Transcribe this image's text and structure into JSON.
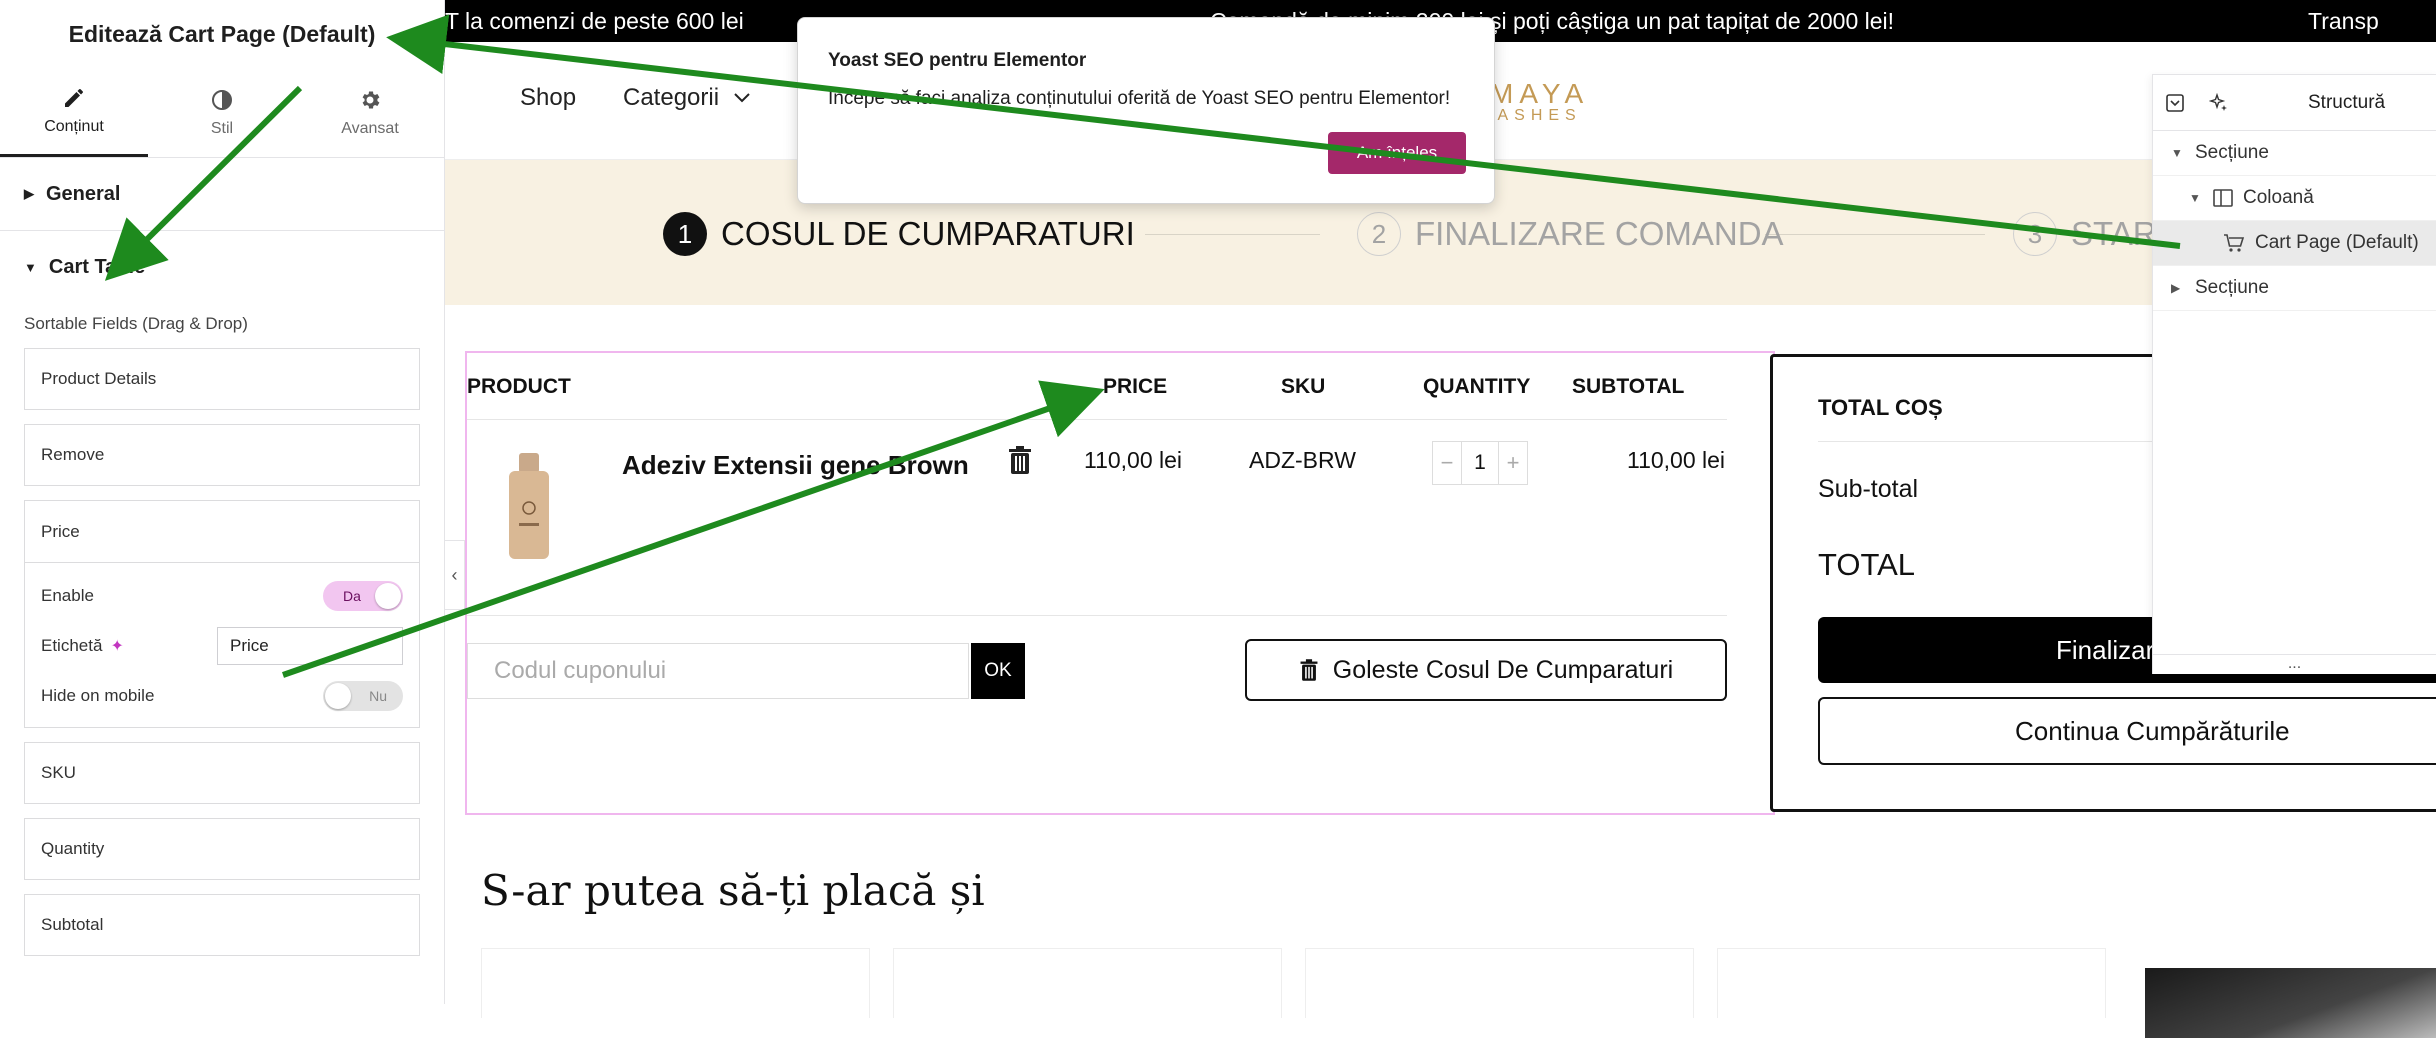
{
  "editor": {
    "title": "Editează Cart Page (Default)",
    "tabs": [
      {
        "label": "Conținut",
        "icon": "pencil-icon",
        "active": true
      },
      {
        "label": "Stil",
        "icon": "contrast-icon",
        "active": false
      },
      {
        "label": "Avansat",
        "icon": "gear-icon",
        "active": false
      }
    ],
    "sections": {
      "general": "General",
      "cart_table": "Cart Table"
    },
    "sortable_label": "Sortable Fields (Drag & Drop)",
    "fields": {
      "product_details": "Product Details",
      "remove": "Remove",
      "price": "Price",
      "sku": "SKU",
      "quantity": "Quantity",
      "subtotal": "Subtotal"
    },
    "price_controls": {
      "enable_label": "Enable",
      "enable_value": "Da",
      "label_label": "Etichetă",
      "label_value": "Price",
      "hide_mobile_label": "Hide on mobile",
      "hide_mobile_value": "Nu"
    }
  },
  "announcements": [
    "T la comenzi de peste 600 lei",
    "Comandă de minim 200 lei și poți câștiga un pat tapițat de 2000 lei!",
    "Transp"
  ],
  "header": {
    "nav_shop": "Shop",
    "nav_categorii": "Categorii",
    "logo_line1": "MAYA",
    "logo_line2": "ASHES"
  },
  "steps": [
    {
      "num": "1",
      "label": "COSUL DE CUMPARATURI"
    },
    {
      "num": "2",
      "label": "FINALIZARE COMANDA"
    },
    {
      "num": "3",
      "label": "STAR"
    }
  ],
  "cart": {
    "headers": {
      "product": "PRODUCT",
      "price": "PRICE",
      "sku": "SKU",
      "quantity": "QUANTITY",
      "subtotal": "SUBTOTAL"
    },
    "item": {
      "name": "Adeziv Extensii gene Brown",
      "price": "110,00 lei",
      "sku": "ADZ-BRW",
      "quantity": "1",
      "subtotal": "110,00 lei"
    },
    "coupon_placeholder": "Codul cuponului",
    "coupon_button": "OK",
    "empty_cart": "Goleste Cosul De Cumparaturi"
  },
  "totals": {
    "title": "TOTAL COȘ",
    "subtotal_label": "Sub-total",
    "total_label": "TOTAL",
    "checkout": "Finalizare",
    "continue": "Continua Cumpărăturile"
  },
  "related_title": "S-ar putea să-ți placă și",
  "yoast": {
    "title": "Yoast SEO pentru Elementor",
    "text": "Începe să faci analiza conținutului oferită de Yoast SEO pentru Elementor!",
    "button": "Am înțeles"
  },
  "structure": {
    "title": "Structură",
    "items": [
      {
        "label": "Secțiune",
        "level": 0,
        "expanded": true
      },
      {
        "label": "Coloană",
        "level": 1,
        "expanded": true
      },
      {
        "label": "Cart Page (Default)",
        "level": 2,
        "selected": true
      },
      {
        "label": "Secțiune",
        "level": 0,
        "expanded": false
      }
    ],
    "ellipsis": "..."
  },
  "colors": {
    "accent_pink": "#f2c6f0",
    "yoast_button": "#a4286a",
    "logo_gold": "#c49a55",
    "steps_bg": "#f8f1e2",
    "annotation_arrow": "#1e8a1e"
  }
}
